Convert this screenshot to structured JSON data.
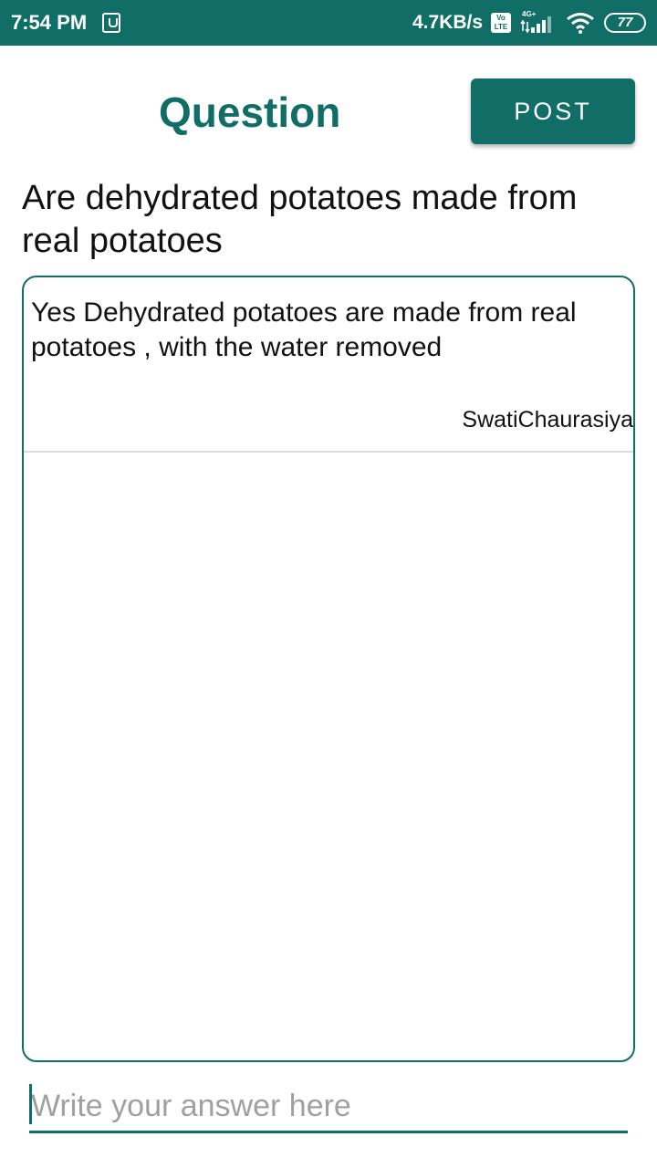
{
  "status_bar": {
    "time": "7:54 PM",
    "network_speed": "4.7KB/s",
    "volte_label": "Vo LTE",
    "network_type": "4G+",
    "battery_level": "77",
    "icons": [
      "download-icon",
      "volte-icon",
      "signal-icon",
      "wifi-icon",
      "battery-icon"
    ]
  },
  "header": {
    "title": "Question",
    "post_label": "POST"
  },
  "question": {
    "text": "Are dehydrated potatoes made from real potatoes"
  },
  "answers": [
    {
      "text": "Yes Dehydrated potatoes are made from real potatoes , with the water removed",
      "author": "SwatiChaurasiya"
    }
  ],
  "answer_input": {
    "placeholder": "Write your answer here",
    "value": ""
  },
  "colors": {
    "primary": "#116e66",
    "text": "#111111",
    "placeholder": "#a0a0a0",
    "divider": "#dddddd"
  }
}
